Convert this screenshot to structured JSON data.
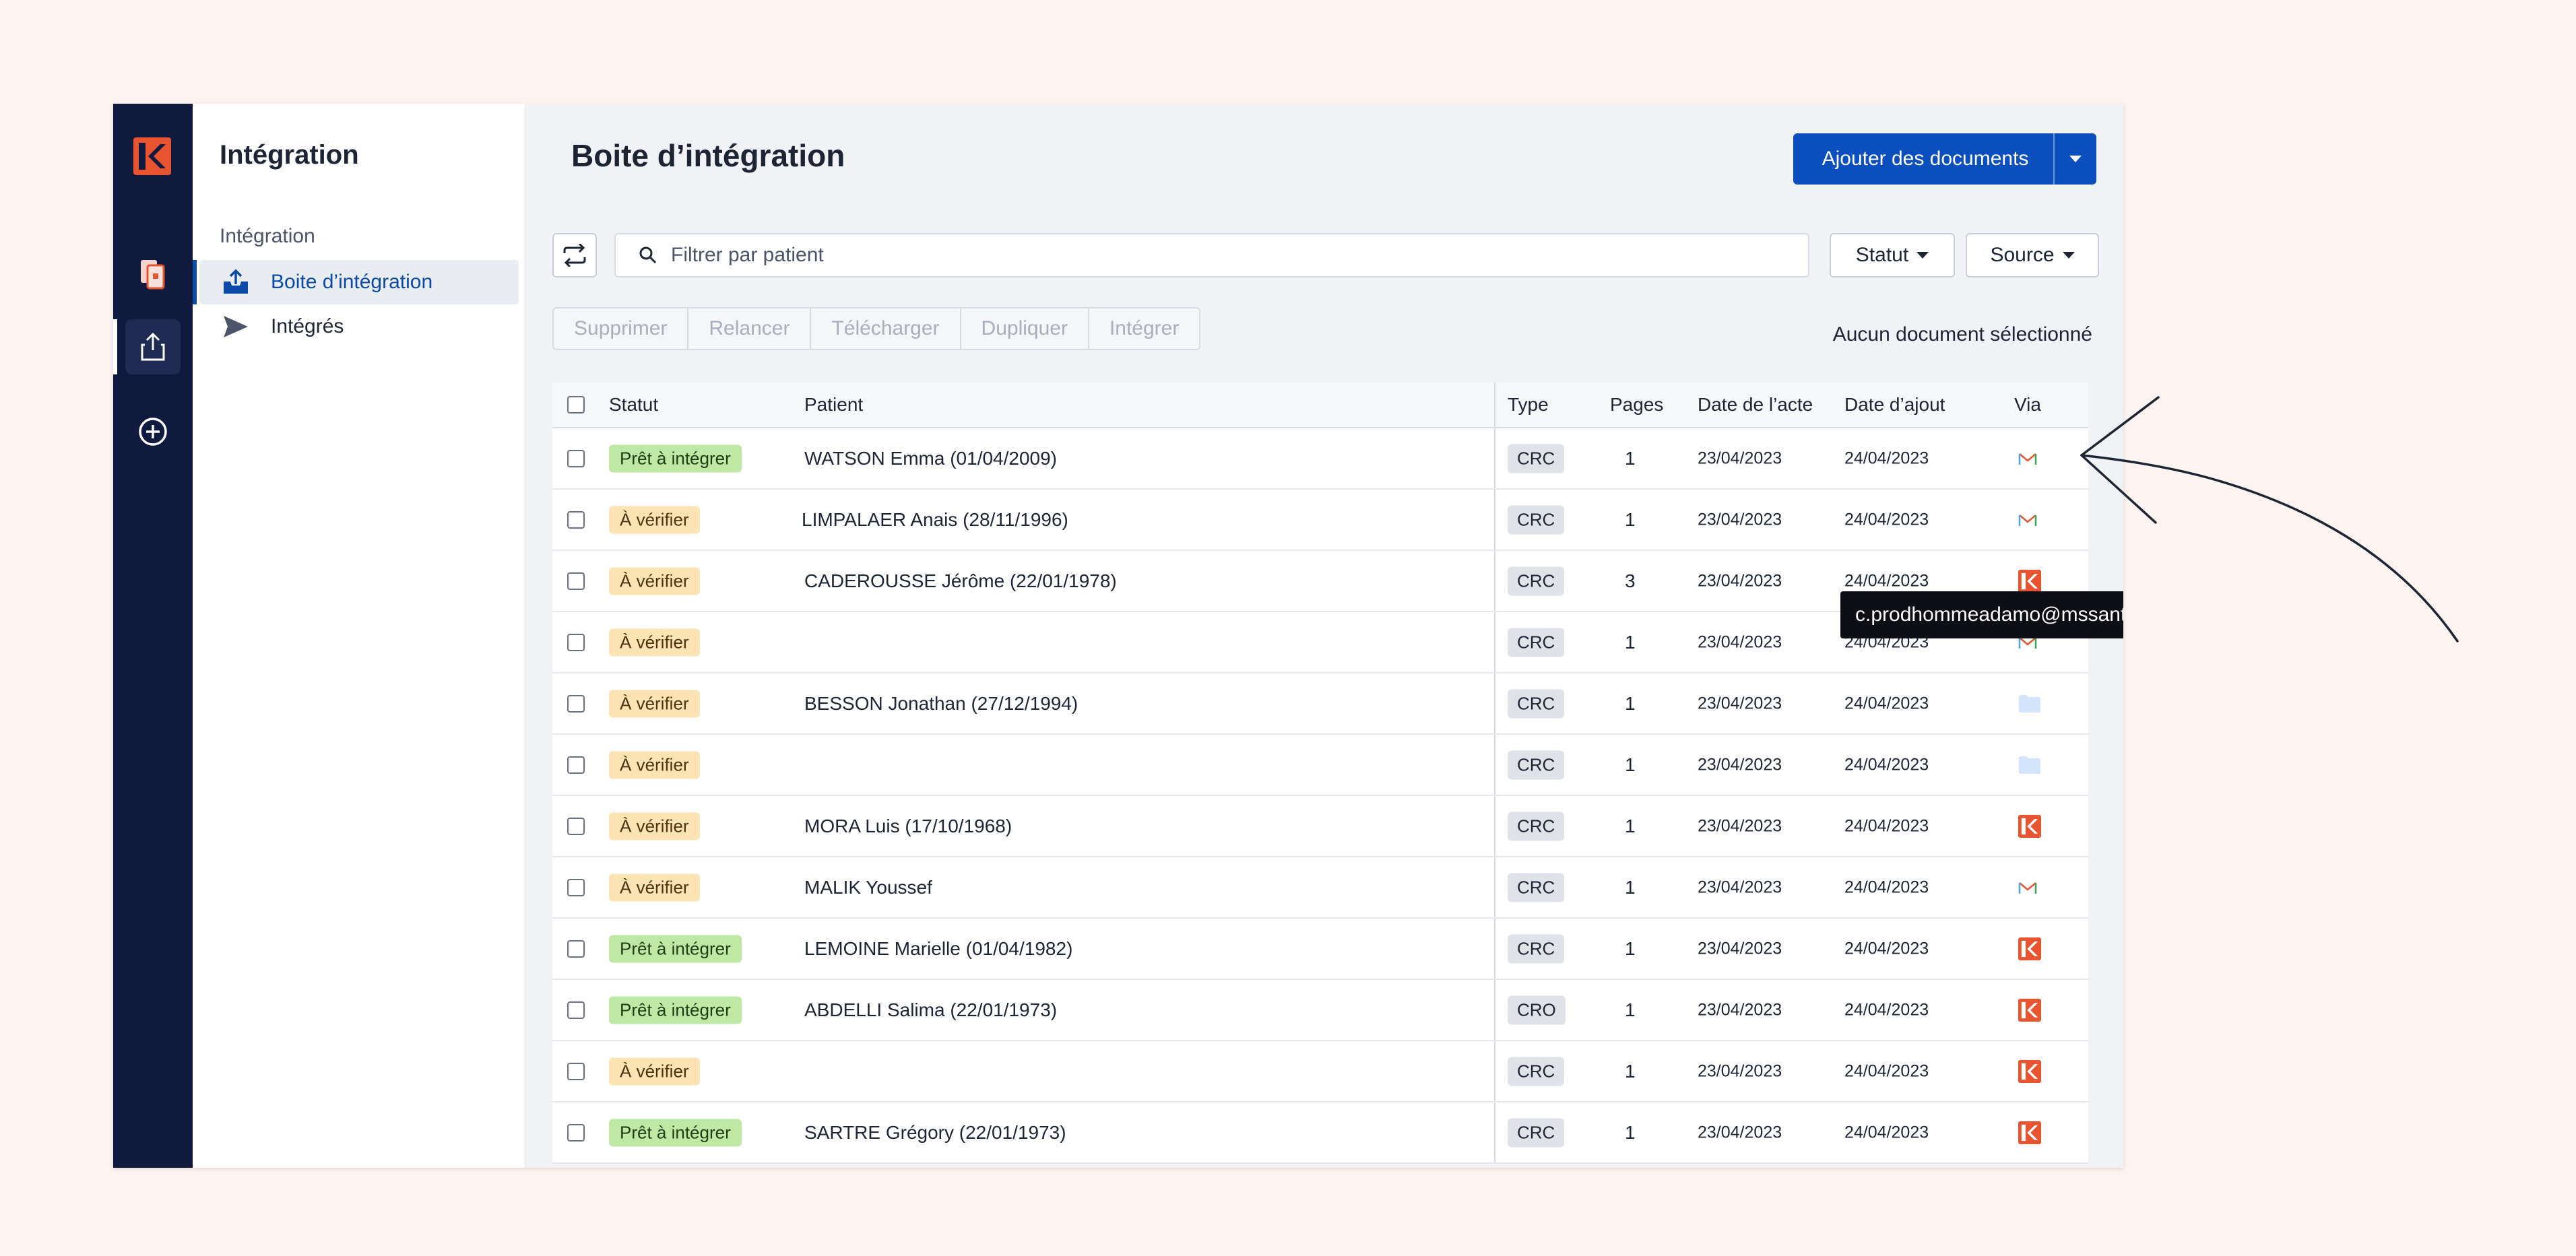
{
  "sidebar": {
    "title": "Intégration",
    "section": "Intégration",
    "items": [
      {
        "label": "Boite d’intégration",
        "icon": "inbox-upload-icon",
        "active": true
      },
      {
        "label": "Intégrés",
        "icon": "send-icon",
        "active": false
      }
    ]
  },
  "header": {
    "title": "Boite d’intégration",
    "add_label": "Ajouter des documents"
  },
  "search": {
    "placeholder": "Filtrer par patient",
    "value": ""
  },
  "filters": {
    "status_label": "Statut",
    "source_label": "Source"
  },
  "actions": [
    "Supprimer",
    "Relancer",
    "Télécharger",
    "Dupliquer",
    "Intégrer"
  ],
  "selection_text": "Aucun document sélectionné",
  "table": {
    "columns": {
      "status": "Statut",
      "patient": "Patient",
      "type": "Type",
      "pages": "Pages",
      "act_date": "Date de l’acte",
      "add_date": "Date d’ajout",
      "via": "Via"
    },
    "rows": [
      {
        "status": "Prêt à intégrer",
        "state": "ready",
        "patient": "WATSON Emma (01/04/2009)",
        "type": "CRC",
        "pages": "1",
        "act_date": "23/04/2023",
        "add_date": "24/04/2023",
        "via": "mail-icon"
      },
      {
        "status": "À vérifier",
        "state": "verify",
        "patient": "LIMPALAER Anais  (28/11/1996)",
        "type": "CRC",
        "pages": "1",
        "act_date": "23/04/2023",
        "add_date": "24/04/2023",
        "via": "mail-icon"
      },
      {
        "status": "À vérifier",
        "state": "verify",
        "patient": "CADEROUSSE Jérôme (22/01/1978)",
        "type": "CRC",
        "pages": "3",
        "act_date": "23/04/2023",
        "add_date": "24/04/2023",
        "via": "app-logo-icon"
      },
      {
        "status": "À vérifier",
        "state": "verify",
        "patient": "",
        "type": "CRC",
        "pages": "1",
        "act_date": "23/04/2023",
        "add_date": "24/04/2023",
        "via": "mail-icon"
      },
      {
        "status": "À vérifier",
        "state": "verify",
        "patient": "BESSON Jonathan (27/12/1994)",
        "type": "CRC",
        "pages": "1",
        "act_date": "23/04/2023",
        "add_date": "24/04/2023",
        "via": "folder-icon"
      },
      {
        "status": "À vérifier",
        "state": "verify",
        "patient": "",
        "type": "CRC",
        "pages": "1",
        "act_date": "23/04/2023",
        "add_date": "24/04/2023",
        "via": "folder-icon"
      },
      {
        "status": "À vérifier",
        "state": "verify",
        "patient": "MORA Luis (17/10/1968)",
        "type": "CRC",
        "pages": "1",
        "act_date": "23/04/2023",
        "add_date": "24/04/2023",
        "via": "app-logo-icon"
      },
      {
        "status": "À vérifier",
        "state": "verify",
        "patient": "MALIK Youssef",
        "type": "CRC",
        "pages": "1",
        "act_date": "23/04/2023",
        "add_date": "24/04/2023",
        "via": "mail-icon"
      },
      {
        "status": "Prêt à intégrer",
        "state": "ready",
        "patient": "LEMOINE Marielle (01/04/1982)",
        "type": "CRC",
        "pages": "1",
        "act_date": "23/04/2023",
        "add_date": "24/04/2023",
        "via": "app-logo-icon"
      },
      {
        "status": "Prêt à intégrer",
        "state": "ready",
        "patient": "ABDELLI Salima (22/01/1973)",
        "type": "CRO",
        "pages": "1",
        "act_date": "23/04/2023",
        "add_date": "24/04/2023",
        "via": "app-logo-icon"
      },
      {
        "status": "À vérifier",
        "state": "verify",
        "patient": "",
        "type": "CRC",
        "pages": "1",
        "act_date": "23/04/2023",
        "add_date": "24/04/2023",
        "via": "app-logo-icon"
      },
      {
        "status": "Prêt à intégrer",
        "state": "ready",
        "patient": "SARTRE Grégory (22/01/1973)",
        "type": "CRC",
        "pages": "1",
        "act_date": "23/04/2023",
        "add_date": "24/04/2023",
        "via": "app-logo-icon"
      }
    ]
  },
  "tooltip": {
    "text": "c.prodhommeadamo@mssante.fr"
  },
  "colors": {
    "accent": "#0a4fbd",
    "rail": "#0f1a3e",
    "brand": "#e8542f",
    "ready": "#bfe8a5",
    "verify": "#fbe3b3"
  }
}
